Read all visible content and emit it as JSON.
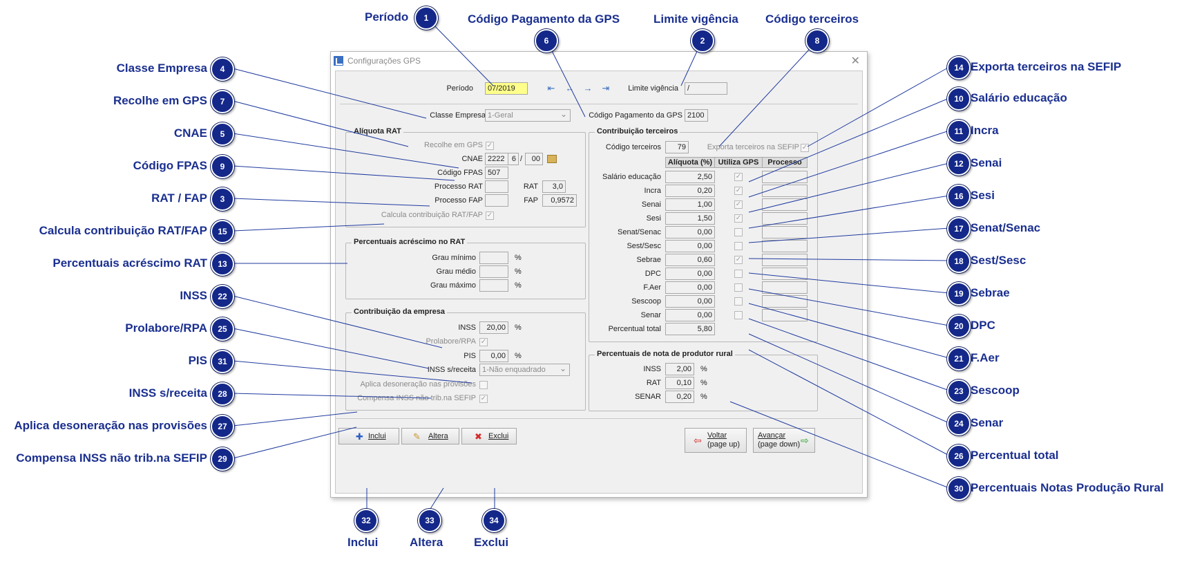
{
  "window": {
    "title": "Configurações GPS",
    "close": "✕"
  },
  "top": {
    "periodo_label": "Período",
    "periodo_value": "07/2019",
    "nav": [
      "⇤",
      "←",
      "→",
      "⇥"
    ],
    "limite_label": "Limite vigência",
    "limite_value": "/",
    "classe_label": "Classe Empresa",
    "classe_value": "1-Geral",
    "codigo_pag_label": "Código Pagamento da GPS",
    "codigo_pag_value": "2100"
  },
  "rat": {
    "title": "Alíquota RAT",
    "recolhe_label": "Recolhe em GPS",
    "recolhe_checked": "✓",
    "cnae_label": "CNAE",
    "cnae_1": "2222",
    "cnae_2": "6",
    "cnae_sep": "/",
    "cnae_3": "00",
    "fpas_label": "Código FPAS",
    "fpas_value": "507",
    "proc_rat_label": "Processo RAT",
    "rat_label": "RAT",
    "rat_value": "3,0",
    "proc_fap_label": "Processo FAP",
    "fap_label": "FAP",
    "fap_value": "0,9572",
    "calcula_label": "Calcula contribuição RAT/FAP",
    "calcula_checked": "✓"
  },
  "acrescimo": {
    "title": "Percentuais acréscimo no RAT",
    "rows": [
      {
        "label": "Grau mínimo",
        "value": "",
        "unit": "%"
      },
      {
        "label": "Grau médio",
        "value": "",
        "unit": "%"
      },
      {
        "label": "Grau máximo",
        "value": "",
        "unit": "%"
      }
    ]
  },
  "empresa": {
    "title": "Contribuição da empresa",
    "inss_label": "INSS",
    "inss_value": "20,00",
    "inss_unit": "%",
    "prolabore_label": "Prolabore/RPA",
    "prolabore_checked": "✓",
    "pis_label": "PIS",
    "pis_value": "0,00",
    "pis_unit": "%",
    "inss_receita_label": "INSS s/receita",
    "inss_receita_value": "1-Não enquadrado",
    "aplica_label": "Aplica desoneração nas provisões",
    "compensa_label": "Compensa INSS não trib.na SEFIP",
    "compensa_checked": "✓"
  },
  "terceiros": {
    "title": "Contribuição terceiros",
    "codigo_label": "Código terceiros",
    "codigo_value": "79",
    "exporta_label": "Exporta terceiros na SEFIP",
    "exporta_checked": "✓",
    "headers": [
      "Alíquota (%)",
      "Utiliza GPS",
      "Processo"
    ],
    "rows": [
      {
        "label": "Salário educação",
        "value": "2,50",
        "gps": "✓"
      },
      {
        "label": "Incra",
        "value": "0,20",
        "gps": "✓"
      },
      {
        "label": "Senai",
        "value": "1,00",
        "gps": "✓"
      },
      {
        "label": "Sesi",
        "value": "1,50",
        "gps": "✓"
      },
      {
        "label": "Senat/Senac",
        "value": "0,00",
        "gps": ""
      },
      {
        "label": "Sest/Sesc",
        "value": "0,00",
        "gps": ""
      },
      {
        "label": "Sebrae",
        "value": "0,60",
        "gps": "✓"
      },
      {
        "label": "DPC",
        "value": "0,00",
        "gps": ""
      },
      {
        "label": "F.Aer",
        "value": "0,00",
        "gps": ""
      },
      {
        "label": "Sescoop",
        "value": "0,00",
        "gps": ""
      },
      {
        "label": "Senar",
        "value": "0,00",
        "gps": ""
      }
    ],
    "total_label": "Percentual total",
    "total_value": "5,80"
  },
  "rural": {
    "title": "Percentuais de nota de produtor rural",
    "rows": [
      {
        "label": "INSS",
        "value": "2,00",
        "unit": "%"
      },
      {
        "label": "RAT",
        "value": "0,10",
        "unit": "%"
      },
      {
        "label": "SENAR",
        "value": "0,20",
        "unit": "%"
      }
    ]
  },
  "buttons": {
    "inclui": "Inclui",
    "altera": "Altera",
    "exclui": "Exclui",
    "voltar_1": "Voltar",
    "voltar_2": "(page up)",
    "avancar_1": "Avançar",
    "avancar_2": "(page down)"
  },
  "annotations": [
    {
      "n": "1",
      "label": "Período"
    },
    {
      "n": "6",
      "label": "Código Pagamento da GPS"
    },
    {
      "n": "2",
      "label": "Limite vigência"
    },
    {
      "n": "8",
      "label": "Código terceiros"
    },
    {
      "n": "4",
      "label": "Classe Empresa"
    },
    {
      "n": "7",
      "label": "Recolhe em GPS"
    },
    {
      "n": "5",
      "label": "CNAE"
    },
    {
      "n": "9",
      "label": "Código FPAS"
    },
    {
      "n": "3",
      "label": "RAT / FAP"
    },
    {
      "n": "15",
      "label": "Calcula contribuição RAT/FAP"
    },
    {
      "n": "13",
      "label": "Percentuais acréscimo RAT"
    },
    {
      "n": "22",
      "label": "INSS"
    },
    {
      "n": "25",
      "label": "Prolabore/RPA"
    },
    {
      "n": "31",
      "label": "PIS"
    },
    {
      "n": "28",
      "label": "INSS s/receita"
    },
    {
      "n": "27",
      "label": "Aplica desoneração nas provisões"
    },
    {
      "n": "29",
      "label": "Compensa INSS não trib.na SEFIP"
    },
    {
      "n": "14",
      "label": "Exporta terceiros na SEFIP"
    },
    {
      "n": "10",
      "label": "Salário educação"
    },
    {
      "n": "11",
      "label": "Incra"
    },
    {
      "n": "12",
      "label": "Senai"
    },
    {
      "n": "16",
      "label": "Sesi"
    },
    {
      "n": "17",
      "label": "Senat/Senac"
    },
    {
      "n": "18",
      "label": "Sest/Sesc"
    },
    {
      "n": "19",
      "label": "Sebrae"
    },
    {
      "n": "20",
      "label": "DPC"
    },
    {
      "n": "21",
      "label": "F.Aer"
    },
    {
      "n": "23",
      "label": "Sescoop"
    },
    {
      "n": "24",
      "label": "Senar"
    },
    {
      "n": "26",
      "label": "Percentual total"
    },
    {
      "n": "30",
      "label": "Percentuais Notas Produção Rural"
    },
    {
      "n": "32",
      "label": "Inclui"
    },
    {
      "n": "33",
      "label": "Altera"
    },
    {
      "n": "34",
      "label": "Exclui"
    }
  ]
}
